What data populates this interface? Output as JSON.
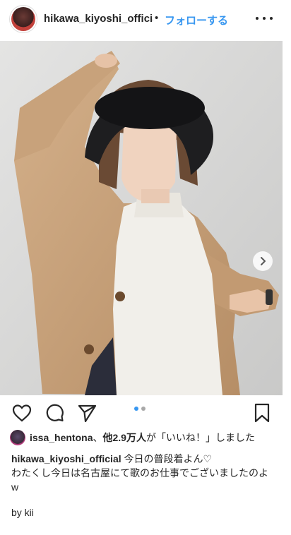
{
  "header": {
    "username": "hikawa_kiyoshi_officia",
    "separator": "•",
    "follow_label": "フォローする",
    "more_icon": "more-horizontal-icon"
  },
  "post": {
    "carousel": {
      "current_index": 1,
      "total": 2,
      "next_icon": "chevron-right-icon"
    },
    "photo_description_icon": "photo-image"
  },
  "actions": {
    "like_icon": "heart-icon",
    "comment_icon": "comment-icon",
    "share_icon": "send-icon",
    "save_icon": "bookmark-icon"
  },
  "likes": {
    "user": "issa_hentona",
    "others": "他2.9万人",
    "suffix": "が「いいね！」しました"
  },
  "caption": {
    "author": "hikawa_kiyoshi_official",
    "line1_text": "今日の普段着よん♡",
    "line2": "わたくし今日は名古屋にて歌のお仕事でございましたのよ",
    "line3": "w",
    "signature": "by kii"
  },
  "colors": {
    "accent": "#3897f0",
    "text": "#262626",
    "pager_active": "#3897f0",
    "pager_inactive": "#a8a8a8"
  }
}
